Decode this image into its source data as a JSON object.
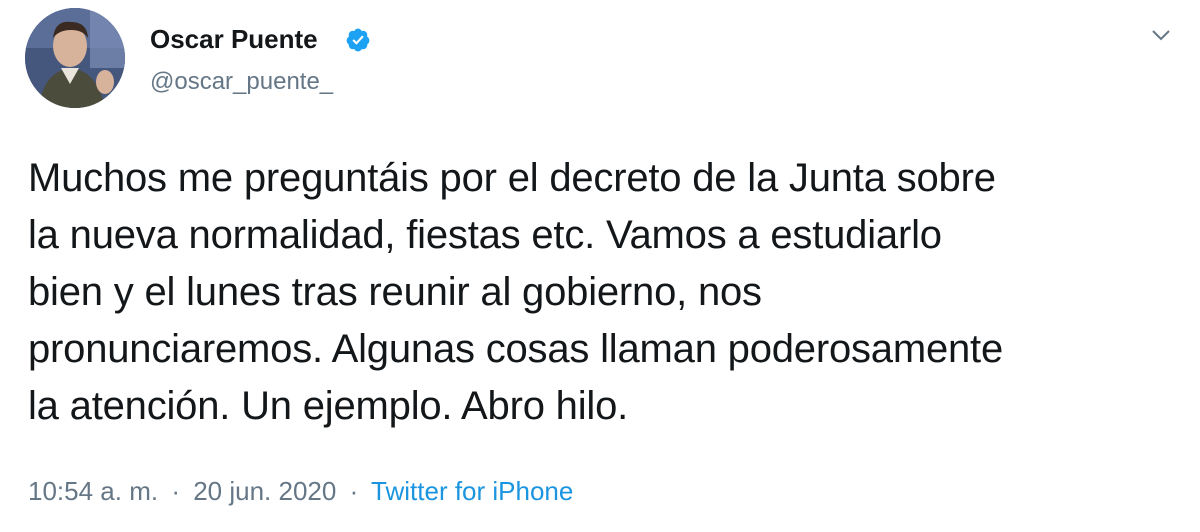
{
  "tweet": {
    "author": {
      "display_name": "Oscar Puente",
      "handle": "@oscar_puente_",
      "verified": true,
      "avatar_icon": "profile-photo"
    },
    "text": "Muchos me preguntáis por el decreto de la Junta sobre\nla nueva normalidad, fiestas etc. Vamos a estudiarlo\nbien y el lunes tras reunir al gobierno, nos\npronunciaremos. Algunas cosas llaman poderosamente\nla atención. Un ejemplo. Abro hilo.",
    "time": "10:54 a. m.",
    "separator": "·",
    "date": "20 jun. 2020",
    "source": "Twitter for iPhone"
  },
  "icons": {
    "verified": "verified-badge-icon",
    "more": "chevron-down-icon"
  },
  "colors": {
    "text": "#14171a",
    "secondary": "#657786",
    "link": "#1b95e0",
    "verified": "#1da1f2"
  }
}
